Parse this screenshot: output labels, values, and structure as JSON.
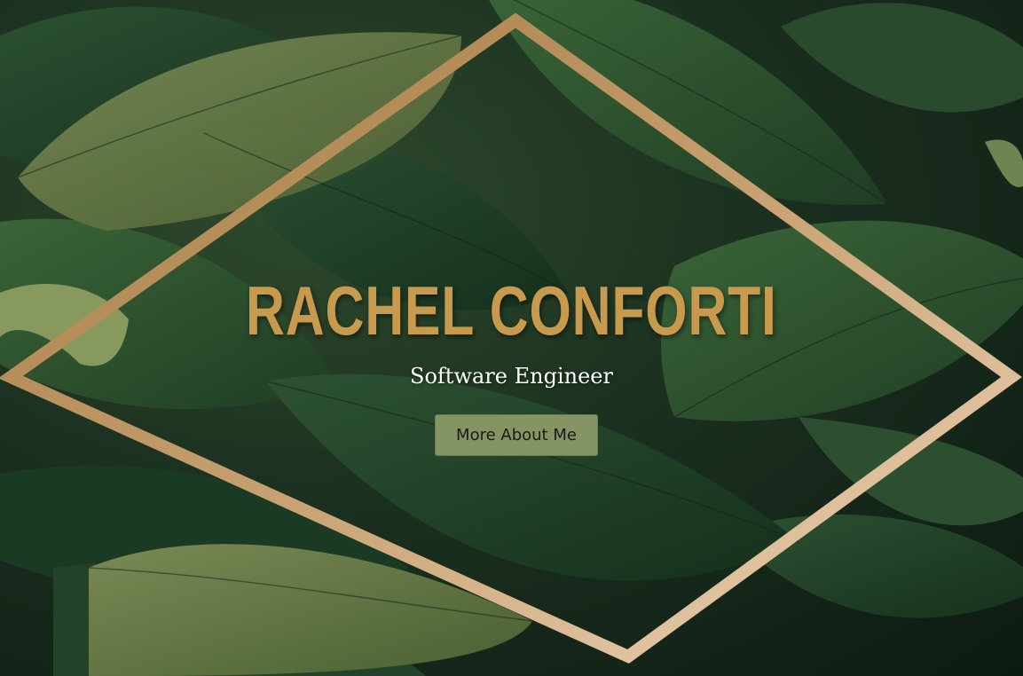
{
  "hero": {
    "name": "RACHEL CONFORTI",
    "subtitle": "Software Engineer",
    "button_label": "More About Me"
  },
  "colors": {
    "name_gold": "#c79a4e",
    "subtitle": "#ffffff",
    "button_bg": "#849462",
    "button_text": "#1a1a1a",
    "frame_gold_dark": "#a57c45",
    "frame_gold_light": "#ecd2b4",
    "leaf_dark": "#1d3a25",
    "leaf_light": "#6c7f45"
  },
  "background": {
    "image": "tropical-leaves-background",
    "frame": "diamond-frame"
  }
}
